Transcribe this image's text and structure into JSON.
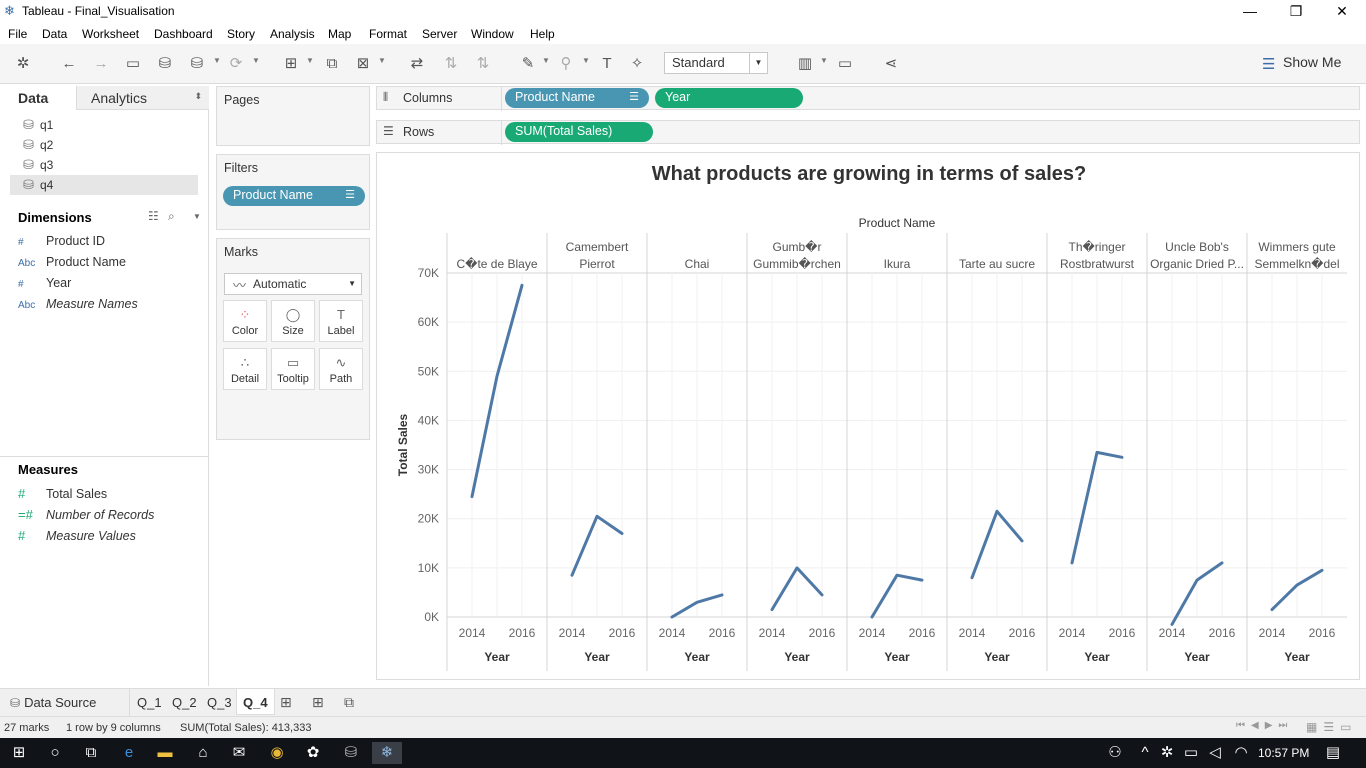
{
  "window": {
    "title": "Tableau - Final_Visualisation",
    "minimize": "—",
    "restore": "❐",
    "close": "✕"
  },
  "menu": [
    "File",
    "Data",
    "Worksheet",
    "Dashboard",
    "Story",
    "Analysis",
    "Map",
    "Format",
    "Server",
    "Window",
    "Help"
  ],
  "toolbar": {
    "fit": "Standard",
    "show_me": "Show Me"
  },
  "left_pane": {
    "tabs": {
      "data": "Data",
      "analytics": "Analytics"
    },
    "data_sources": [
      "q1",
      "q2",
      "q3",
      "q4"
    ],
    "dimensions_header": "Dimensions",
    "dimensions": [
      {
        "type": "#",
        "name": "Product ID",
        "italic": false
      },
      {
        "type": "Abc",
        "name": "Product Name",
        "italic": false
      },
      {
        "type": "#",
        "name": "Year",
        "italic": false
      },
      {
        "type": "Abc",
        "name": "Measure Names",
        "italic": true
      }
    ],
    "measures_header": "Measures",
    "measures": [
      {
        "type": "#",
        "name": "Total Sales",
        "italic": false
      },
      {
        "type": "=#",
        "name": "Number of Records",
        "italic": true
      },
      {
        "type": "#",
        "name": "Measure Values",
        "italic": true
      }
    ]
  },
  "cards": {
    "pages": "Pages",
    "filters": "Filters",
    "filter_pill": "Product Name",
    "marks": "Marks",
    "mark_type": "Automatic",
    "mark_buttons": [
      "Color",
      "Size",
      "Label",
      "Detail",
      "Tooltip",
      "Path"
    ]
  },
  "shelves": {
    "columns_label": "Columns",
    "rows_label": "Rows",
    "columns_pills": [
      "Product Name",
      "Year"
    ],
    "rows_pills": [
      "SUM(Total Sales)"
    ]
  },
  "chart_data": {
    "type": "line",
    "title": "What products are growing in terms of sales?",
    "column_header": "Product Name",
    "xlabel": "Year",
    "ylabel": "Total Sales",
    "ylim": [
      0,
      70000
    ],
    "y_ticks": [
      "0K",
      "10K",
      "20K",
      "30K",
      "40K",
      "50K",
      "60K",
      "70K"
    ],
    "x_tick_labels": [
      "2014",
      "2016"
    ],
    "x": [
      2014,
      2015,
      2016
    ],
    "panels": [
      {
        "name": "C�te de Blaye",
        "values": [
          24500,
          49000,
          67500
        ]
      },
      {
        "name": "Camembert Pierrot",
        "values": [
          8500,
          20500,
          17000
        ]
      },
      {
        "name": "Chai",
        "values": [
          0,
          3000,
          4500
        ]
      },
      {
        "name": "Gumb�r Gummib�rchen",
        "values": [
          1500,
          10000,
          4500
        ]
      },
      {
        "name": "Ikura",
        "values": [
          0,
          8500,
          7500
        ]
      },
      {
        "name": "Tarte au sucre",
        "values": [
          8000,
          21500,
          15500
        ]
      },
      {
        "name": "Th�ringer Rostbratwurst",
        "values": [
          11000,
          33500,
          32500
        ]
      },
      {
        "name": "Uncle Bob's Organic Dried P...",
        "values": [
          -1500,
          7500,
          11000
        ]
      },
      {
        "name": "Wimmers gute Semmelkn�del",
        "values": [
          1500,
          6500,
          9500
        ]
      }
    ],
    "line_color": "#4e79a7",
    "grid": true
  },
  "sheet_tabs": {
    "data_source": "Data Source",
    "sheets": [
      "Q_1",
      "Q_2",
      "Q_3",
      "Q_4"
    ],
    "active": "Q_4"
  },
  "status": {
    "marks": "27 marks",
    "layout": "1 row by 9 columns",
    "sum": "SUM(Total Sales): 413,333"
  },
  "taskbar": {
    "time": "10:57 PM"
  }
}
